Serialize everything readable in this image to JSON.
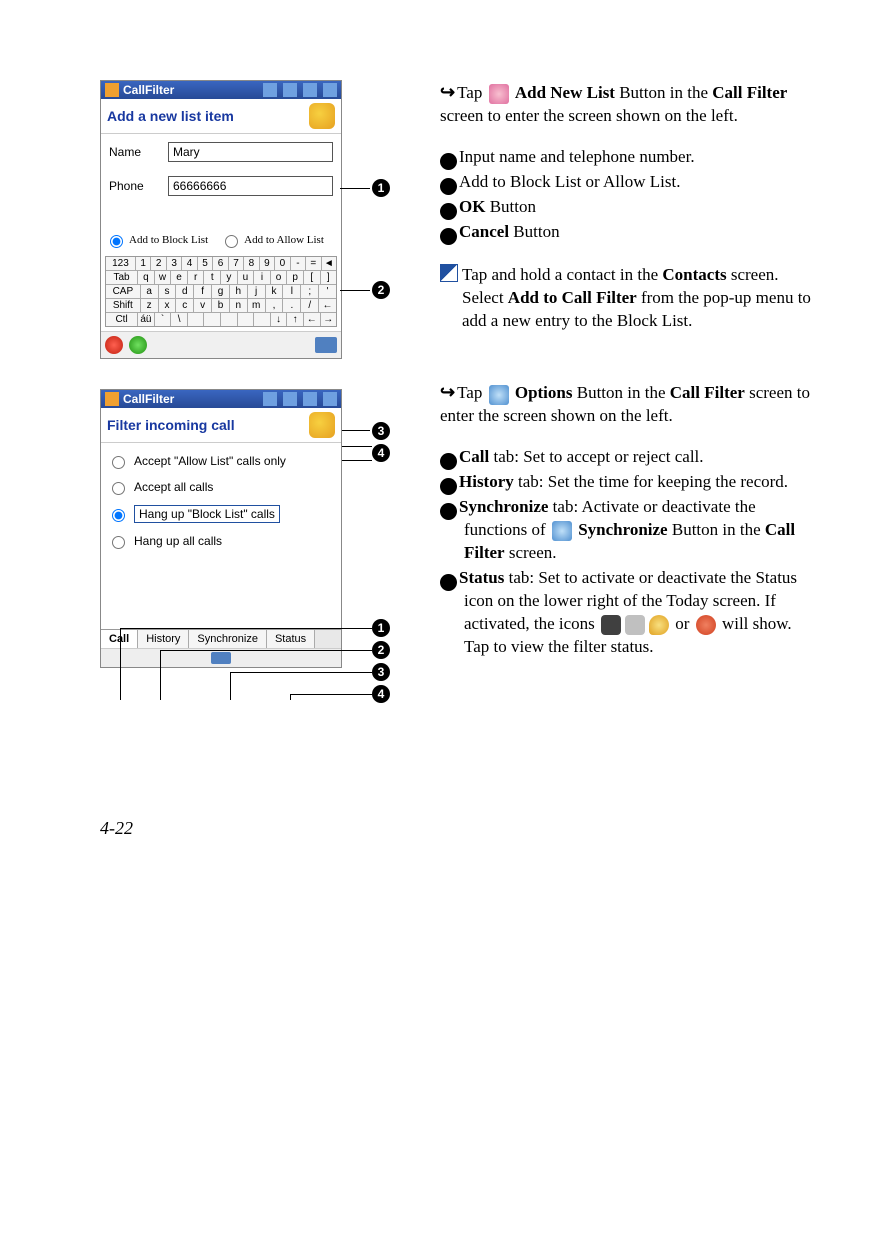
{
  "page_number": "4-22",
  "pda1": {
    "title": "CallFilter",
    "header": "Add a new list item",
    "name_label": "Name",
    "name_value": "Mary",
    "phone_label": "Phone",
    "phone_value": "66666666",
    "radio_block": "Add to Block List",
    "radio_allow": "Add to Allow List",
    "keyboard_rows": [
      [
        "123",
        "1",
        "2",
        "3",
        "4",
        "5",
        "6",
        "7",
        "8",
        "9",
        "0",
        "-",
        "=",
        "◄"
      ],
      [
        "Tab",
        "q",
        "w",
        "e",
        "r",
        "t",
        "y",
        "u",
        "i",
        "o",
        "p",
        "[",
        "]"
      ],
      [
        "CAP",
        "a",
        "s",
        "d",
        "f",
        "g",
        "h",
        "j",
        "k",
        "l",
        ";",
        "'"
      ],
      [
        "Shift",
        "z",
        "x",
        "c",
        "v",
        "b",
        "n",
        "m",
        ",",
        ".",
        "/",
        "←"
      ],
      [
        "Ctl",
        "áü",
        "`",
        "\\",
        "",
        "",
        "",
        "",
        "",
        "↓",
        "↑",
        "←",
        "→"
      ]
    ]
  },
  "pda2": {
    "title": "CallFilter",
    "header": "Filter incoming call",
    "options": [
      "Accept \"Allow List\" calls only",
      "Accept all calls",
      "Hang up \"Block List\" calls",
      "Hang up all calls"
    ],
    "selected_index": 2,
    "tabs": [
      "Call",
      "History",
      "Synchronize",
      "Status"
    ]
  },
  "right": {
    "intro1_pre": "Tap ",
    "intro1_bold": "Add New List",
    "intro1_post": " Button in the ",
    "intro1_bold2": "Call Filter",
    "intro1_post2": " screen to enter the screen shown on the left.",
    "n1": "Input name and telephone number.",
    "n2": "Add to Block List or Allow List.",
    "n3_bold": "OK",
    "n3_post": " Button",
    "n4_bold": "Cancel",
    "n4_post": " Button",
    "note1_a": "Tap and hold a contact in the ",
    "note1_b": "Contacts",
    "note1_c": " screen. Select ",
    "note1_d": "Add to Call Filter",
    "note1_e": " from the pop-up menu to add a new entry to the Block List.",
    "intro2_pre": "Tap ",
    "intro2_bold": "Options",
    "intro2_post": " Button in the ",
    "intro2_bold2": "Call Filter",
    "intro2_post2": " screen to enter the screen shown on the left.",
    "tab1_bold": "Call",
    "tab1_post": " tab: Set to accept or reject call.",
    "tab2_bold": "History",
    "tab2_post": " tab: Set the time for keeping the record.",
    "tab3_bold": "Synchronize",
    "tab3_mid1": " tab: Activate or deactivate the functions of ",
    "tab3_bold2": "Synchronize",
    "tab3_mid2": " Button in the ",
    "tab3_bold3": "Call Filter",
    "tab3_post": " screen.",
    "tab4_bold": "Status",
    "tab4_a": " tab: Set to activate or deactivate the Status icon on the lower right of the Today screen. If activated, the icons ",
    "tab4_b": " or ",
    "tab4_c": " will show. Tap to view the filter status."
  }
}
